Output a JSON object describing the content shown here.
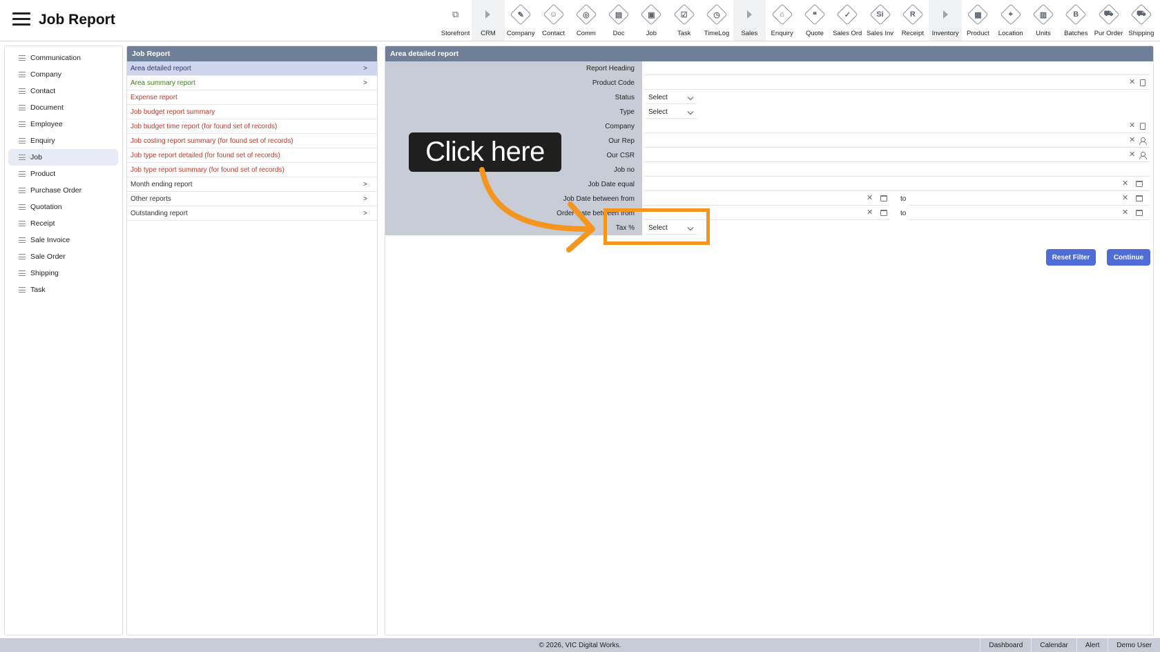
{
  "header": {
    "title": "Job Report",
    "menu_icon": "hamburger-menu-icon"
  },
  "toolbar": [
    {
      "label": "Storefront",
      "icon": "external-link-icon",
      "glyph": "⧉",
      "type": "link"
    },
    {
      "label": "CRM",
      "icon": "section-arrow-icon",
      "glyph": "",
      "type": "section"
    },
    {
      "label": "Company",
      "icon": "company-icon",
      "glyph": "✎",
      "type": "item"
    },
    {
      "label": "Contact",
      "icon": "contact-icon",
      "glyph": "☺",
      "type": "item"
    },
    {
      "label": "Comm",
      "icon": "comm-icon",
      "glyph": "◎",
      "type": "item"
    },
    {
      "label": "Doc",
      "icon": "doc-icon",
      "glyph": "▤",
      "type": "item"
    },
    {
      "label": "Job",
      "icon": "job-icon",
      "glyph": "▣",
      "type": "item"
    },
    {
      "label": "Task",
      "icon": "task-icon",
      "glyph": "☑",
      "type": "item"
    },
    {
      "label": "TimeLog",
      "icon": "timelog-icon",
      "glyph": "◷",
      "type": "item"
    },
    {
      "label": "Sales",
      "icon": "section-arrow-icon",
      "glyph": "",
      "type": "section"
    },
    {
      "label": "Enquiry",
      "icon": "enquiry-icon",
      "glyph": "⌂",
      "type": "item"
    },
    {
      "label": "Quote",
      "icon": "quote-icon",
      "glyph": "❝",
      "type": "item"
    },
    {
      "label": "Sales Ord",
      "icon": "sales-order-icon",
      "glyph": "✓",
      "type": "item"
    },
    {
      "label": "Sales Inv",
      "icon": "sales-invoice-icon",
      "glyph": "Si",
      "type": "item"
    },
    {
      "label": "Receipt",
      "icon": "receipt-icon",
      "glyph": "R",
      "type": "item"
    },
    {
      "label": "Inventory",
      "icon": "section-arrow-icon",
      "glyph": "",
      "type": "section"
    },
    {
      "label": "Product",
      "icon": "product-icon",
      "glyph": "▦",
      "type": "item"
    },
    {
      "label": "Location",
      "icon": "location-icon",
      "glyph": "⌖",
      "type": "item"
    },
    {
      "label": "Units",
      "icon": "units-icon",
      "glyph": "▥",
      "type": "item"
    },
    {
      "label": "Batches",
      "icon": "batches-icon",
      "glyph": "B",
      "type": "item"
    },
    {
      "label": "Pur Order",
      "icon": "purchase-order-icon",
      "glyph": "⛟",
      "type": "item"
    },
    {
      "label": "Shipping",
      "icon": "shipping-icon",
      "glyph": "⛟",
      "type": "item"
    }
  ],
  "sidebar": {
    "items": [
      {
        "label": "Communication",
        "active": false
      },
      {
        "label": "Company",
        "active": false
      },
      {
        "label": "Contact",
        "active": false
      },
      {
        "label": "Document",
        "active": false
      },
      {
        "label": "Employee",
        "active": false
      },
      {
        "label": "Enquiry",
        "active": false
      },
      {
        "label": "Job",
        "active": true
      },
      {
        "label": "Product",
        "active": false
      },
      {
        "label": "Purchase Order",
        "active": false
      },
      {
        "label": "Quotation",
        "active": false
      },
      {
        "label": "Receipt",
        "active": false
      },
      {
        "label": "Sale Invoice",
        "active": false
      },
      {
        "label": "Sale Order",
        "active": false
      },
      {
        "label": "Shipping",
        "active": false
      },
      {
        "label": "Task",
        "active": false
      }
    ]
  },
  "reports": {
    "title": "Job Report",
    "items": [
      {
        "label": "Area detailed report",
        "color": "dark",
        "chevron": true,
        "selected": true
      },
      {
        "label": "Area summary report",
        "color": "green",
        "chevron": true,
        "selected": false
      },
      {
        "label": "Expense report",
        "color": "red",
        "chevron": false,
        "selected": false
      },
      {
        "label": "Job budget report summary",
        "color": "red",
        "chevron": false,
        "selected": false
      },
      {
        "label": "Job budget time report (for found set of records)",
        "color": "red",
        "chevron": false,
        "selected": false
      },
      {
        "label": "Job costing report summary (for found set of records)",
        "color": "red",
        "chevron": false,
        "selected": false
      },
      {
        "label": "Job type report detailed (for found set of records)",
        "color": "red",
        "chevron": false,
        "selected": false
      },
      {
        "label": "Job type report summary (for found set of records)",
        "color": "red",
        "chevron": false,
        "selected": false
      },
      {
        "label": "Month ending report",
        "color": "dark",
        "chevron": true,
        "selected": false
      },
      {
        "label": "Other reports",
        "color": "dark",
        "chevron": true,
        "selected": false
      },
      {
        "label": "Outstanding report",
        "color": "dark",
        "chevron": true,
        "selected": false
      }
    ],
    "chevron_glyph": ">"
  },
  "form": {
    "title": "Area detailed report",
    "fields": {
      "report_heading": {
        "label": "Report Heading",
        "value": ""
      },
      "product_code": {
        "label": "Product Code",
        "value": ""
      },
      "status": {
        "label": "Status",
        "value": "Select"
      },
      "type": {
        "label": "Type",
        "value": "Select"
      },
      "company": {
        "label": "Company",
        "value": ""
      },
      "our_rep": {
        "label": "Our Rep",
        "value": ""
      },
      "our_csr": {
        "label": "Our CSR",
        "value": ""
      },
      "job_no": {
        "label": "Job no",
        "value": ""
      },
      "job_date_equal": {
        "label": "Job Date equal",
        "value": ""
      },
      "job_date_between": {
        "label": "Job Date between from",
        "from": "",
        "to": ""
      },
      "order_date_between": {
        "label": "Order Date between from",
        "from": "",
        "to": ""
      },
      "tax": {
        "label": "Tax %",
        "value": "Select"
      }
    },
    "to_label": "to",
    "clear_glyph": "✕",
    "buttons": {
      "reset": "Reset Filter",
      "continue": "Continue"
    }
  },
  "callout": {
    "text": "Click here",
    "accent_color": "#f3951f"
  },
  "footer": {
    "copyright": "© 2026, VIC Digital Works.",
    "links": [
      "Dashboard",
      "Calendar",
      "Alert",
      "Demo User"
    ]
  },
  "colors": {
    "panel_header": "#6f7f97",
    "label_column": "#c7ccd7",
    "button": "#4f6bd6",
    "selected_row": "#cfd5ec"
  }
}
